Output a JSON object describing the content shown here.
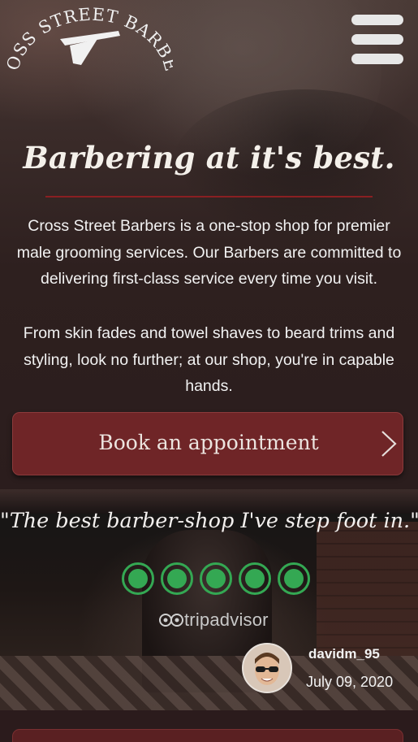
{
  "header": {
    "logo_text": "CROSS STREET BARBERS",
    "logo_icon": "straight-razor-icon",
    "menu_icon": "hamburger-menu-icon"
  },
  "hero": {
    "title": "Barbering at it's best.",
    "paragraph_1": "Cross Street Barbers is a one-stop shop for premier male grooming services. Our Barbers are committed to delivering first-class service every time you visit.",
    "paragraph_2": "From skin fades and towel shaves to beard trims and styling, look no further; at our shop, you're in capable hands.",
    "cta_label": "Book an appointment",
    "cta_icon": "chevron-right-icon"
  },
  "testimonial": {
    "quote": "\"The best barber-shop I've step foot in.\"",
    "rating": 5,
    "rating_max": 5,
    "source_name": "tripadvisor",
    "source_prefix": "trip",
    "source_suffix": "advisor",
    "reviewer": "davidm_95",
    "date": "July 09, 2020"
  },
  "colors": {
    "accent": "#6f2527",
    "divider": "#8a1f22",
    "rating_green": "#34a853",
    "background": "#2a1b1b"
  }
}
